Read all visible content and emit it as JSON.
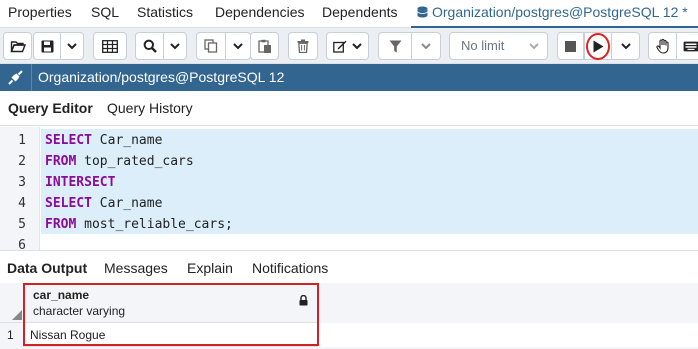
{
  "tabs": {
    "items": [
      {
        "label": "Properties"
      },
      {
        "label": "SQL"
      },
      {
        "label": "Statistics"
      },
      {
        "label": "Dependencies"
      },
      {
        "label": "Dependents"
      },
      {
        "label": "Organization/postgres@PostgreSQL 12 *"
      }
    ],
    "active_icon": "database-icon"
  },
  "toolbar": {
    "open_file_icon": "folder-open-icon",
    "save_icon": "save-icon",
    "save_dropdown_icon": "chevron-down-icon",
    "edit_grid_icon": "grid-icon",
    "find_icon": "search-icon",
    "find_dropdown_icon": "chevron-down-icon",
    "copy_icon": "copy-icon",
    "copy_dropdown_icon": "chevron-down-icon",
    "paste_icon": "paste-icon",
    "delete_icon": "trash-icon",
    "edit_icon": "edit-icon",
    "filter_icon": "filter-icon",
    "filter_dropdown_icon": "chevron-down-icon",
    "limit_value": "No limit",
    "stop_icon": "stop-icon",
    "execute_icon": "play-icon",
    "execute_dropdown_icon": "chevron-down-icon",
    "explain_icon": "hand-icon",
    "more_icon": "keyboard-icon"
  },
  "connection": {
    "icon": "plug-icon",
    "label": "Organization/postgres@PostgreSQL 12",
    "color": "#326690"
  },
  "query_tabs": [
    {
      "label": "Query Editor",
      "active": true
    },
    {
      "label": "Query History",
      "active": false
    }
  ],
  "editor": {
    "lines": [
      {
        "num": "1",
        "kw": "SELECT",
        "rest": " Car_name"
      },
      {
        "num": "2",
        "kw": "FROM",
        "rest": " top_rated_cars"
      },
      {
        "num": "3",
        "kw": "INTERSECT",
        "rest": ""
      },
      {
        "num": "4",
        "kw": "SELECT",
        "rest": " Car_name"
      },
      {
        "num": "5",
        "kw": "FROM",
        "rest": " most_reliable_cars;"
      },
      {
        "num": "6",
        "kw": "",
        "rest": ""
      }
    ],
    "keyword_color": "#8a0c98",
    "selection_color": "#dbeefa"
  },
  "result_tabs": [
    {
      "label": "Data Output",
      "active": true
    },
    {
      "label": "Messages",
      "active": false
    },
    {
      "label": "Explain",
      "active": false
    },
    {
      "label": "Notifications",
      "active": false
    }
  ],
  "results": {
    "columns": [
      {
        "name": "car_name",
        "type": "character varying",
        "icon": "lock-icon"
      }
    ],
    "rows": [
      {
        "num": "1",
        "values": [
          "Nissan Rogue"
        ]
      }
    ]
  },
  "annotation_color": "#d42020"
}
